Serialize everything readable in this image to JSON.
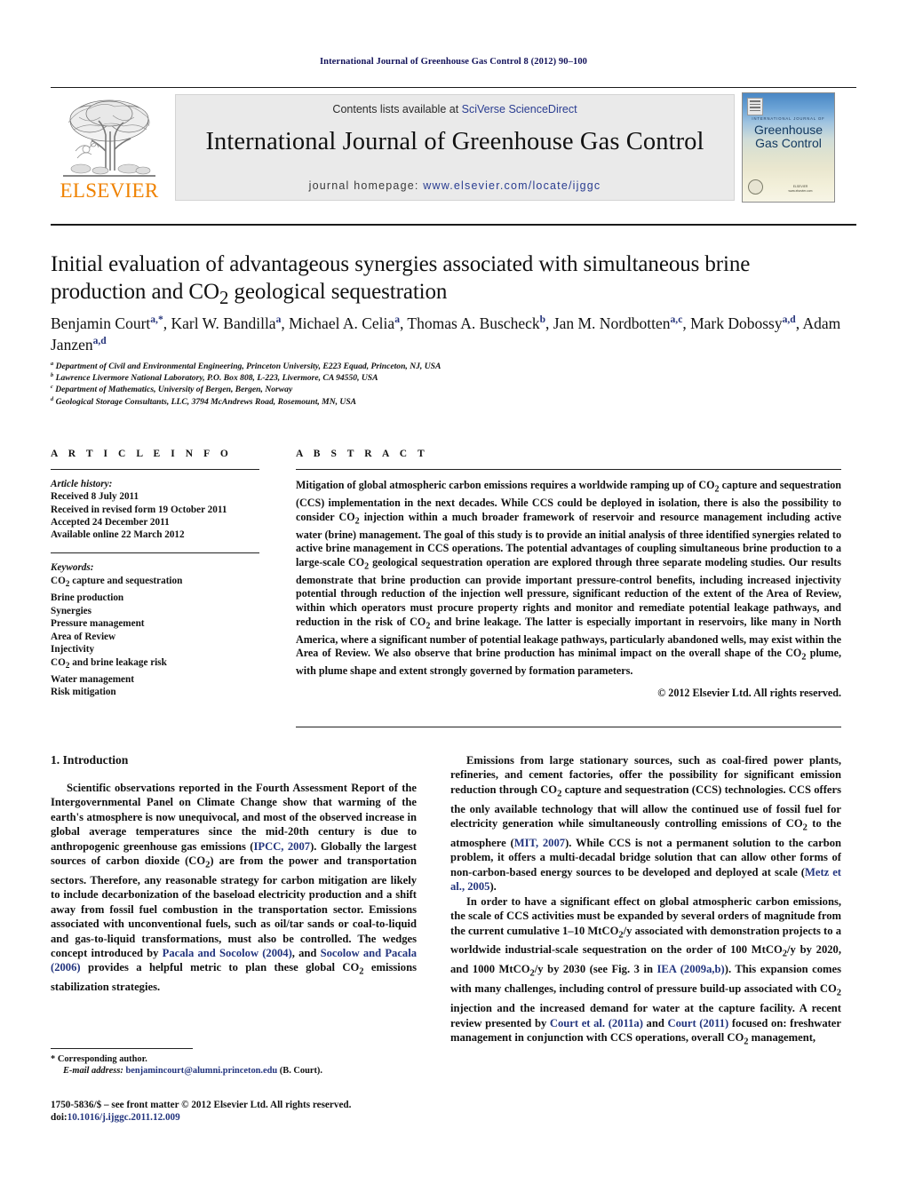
{
  "running_head": "International Journal of Greenhouse Gas Control 8 (2012) 90–100",
  "masthead": {
    "contents_prefix": "Contents lists available at ",
    "contents_link": "SciVerse ScienceDirect",
    "journal_title": "International Journal of Greenhouse Gas Control",
    "homepage_prefix": "journal homepage: ",
    "homepage_url": "www.elsevier.com/locate/ijggc",
    "publisher_logo_text": "ELSEVIER",
    "cover": {
      "kicker": "INTERNATIONAL JOURNAL OF",
      "line1": "Greenhouse",
      "line2": "Gas Control",
      "publisher": "ELSEVIER",
      "publisher_sub": "www.elsevier.com"
    }
  },
  "article": {
    "title_line1": "Initial evaluation of advantageous synergies associated with simultaneous brine",
    "title_line2_pre": "production and CO",
    "title_sub": "2",
    "title_line2_post": " geological sequestration",
    "authors_html": "Benjamin Court<sup>a,*</sup>, Karl W. Bandilla<sup>a</sup>, Michael A. Celia<sup>a</sup>, Thomas A. Buscheck<sup>b</sup>, Jan M. Nordbotten<sup>a,c</sup>, Mark Dobossy<sup>a,d</sup>, Adam Janzen<sup>a,d</sup>",
    "affiliations": [
      {
        "mark": "a",
        "text": "Department of Civil and Environmental Engineering, Princeton University, E223 Equad, Princeton, NJ, USA"
      },
      {
        "mark": "b",
        "text": "Lawrence Livermore National Laboratory, P.O. Box 808, L-223, Livermore, CA 94550, USA"
      },
      {
        "mark": "c",
        "text": "Department of Mathematics, University of Bergen, Bergen, Norway"
      },
      {
        "mark": "d",
        "text": "Geological Storage Consultants, LLC, 3794 McAndrews Road, Rosemount, MN, USA"
      }
    ]
  },
  "article_info": {
    "heading": "A R T I C L E   I N F O",
    "history_label": "Article history:",
    "history": [
      "Received 8 July 2011",
      "Received in revised form 19 October 2011",
      "Accepted 24 December 2011",
      "Available online 22 March 2012"
    ],
    "keywords_label": "Keywords:",
    "keywords": [
      "CO2 capture and sequestration",
      "Brine production",
      "Synergies",
      "Pressure management",
      "Area of Review",
      "Injectivity",
      "CO2 and brine leakage risk",
      "Water management",
      "Risk mitigation"
    ]
  },
  "abstract": {
    "heading": "A B S T R A C T",
    "text": "Mitigation of global atmospheric carbon emissions requires a worldwide ramping up of CO2 capture and sequestration (CCS) implementation in the next decades. While CCS could be deployed in isolation, there is also the possibility to consider CO2 injection within a much broader framework of reservoir and resource management including active water (brine) management. The goal of this study is to provide an initial analysis of three identified synergies related to active brine management in CCS operations. The potential advantages of coupling simultaneous brine production to a large-scale CO2 geological sequestration operation are explored through three separate modeling studies. Our results demonstrate that brine production can provide important pressure-control benefits, including increased injectivity potential through reduction of the injection well pressure, significant reduction of the extent of the Area of Review, within which operators must procure property rights and monitor and remediate potential leakage pathways, and reduction in the risk of CO2 and brine leakage. The latter is especially important in reservoirs, like many in North America, where a significant number of potential leakage pathways, particularly abandoned wells, may exist within the Area of Review. We also observe that brine production has minimal impact on the overall shape of the CO2 plume, with plume shape and extent strongly governed by formation parameters.",
    "copyright": "© 2012 Elsevier Ltd. All rights reserved."
  },
  "body": {
    "section_title": "1. Introduction",
    "left_paragraphs": [
      "Scientific observations reported in the Fourth Assessment Report of the Intergovernmental Panel on Climate Change show that warming of the earth's atmosphere is now unequivocal, and most of the observed increase in global average temperatures since the mid-20th century is due to anthropogenic greenhouse gas emissions (IPCC, 2007). Globally the largest sources of carbon dioxide (CO2) are from the power and transportation sectors. Therefore, any reasonable strategy for carbon mitigation are likely to include decarbonization of the baseload electricity production and a shift away from fossil fuel combustion in the transportation sector. Emissions associated with unconventional fuels, such as oil/tar sands or coal-to-liquid and gas-to-liquid transformations, must also be controlled. The wedges concept introduced by Pacala and Socolow (2004), and Socolow and Pacala (2006) provides a helpful metric to plan these global CO2 emissions stabilization strategies."
    ],
    "right_paragraphs": [
      "Emissions from large stationary sources, such as coal-fired power plants, refineries, and cement factories, offer the possibility for significant emission reduction through CO2 capture and sequestration (CCS) technologies. CCS offers the only available technology that will allow the continued use of fossil fuel for electricity generation while simultaneously controlling emissions of CO2 to the atmosphere (MIT, 2007). While CCS is not a permanent solution to the carbon problem, it offers a multi-decadal bridge solution that can allow other forms of non-carbon-based energy sources to be developed and deployed at scale (Metz et al., 2005).",
      "In order to have a significant effect on global atmospheric carbon emissions, the scale of CCS activities must be expanded by several orders of magnitude from the current cumulative 1–10 MtCO2/y associated with demonstration projects to a worldwide industrial-scale sequestration on the order of 100 MtCO2/y by 2020, and 1000 MtCO2/y by 2030 (see Fig. 3 in IEA (2009a,b)). This expansion comes with many challenges, including control of pressure build-up associated with CO2 injection and the increased demand for water at the capture facility. A recent review presented by Court et al. (2011a) and Court (2011) focused on: freshwater management in conjunction with CCS operations, overall CO2 management,"
    ]
  },
  "footnote": {
    "star": "*",
    "corresponding": "Corresponding author.",
    "email_label": "E-mail address:",
    "email": "benjamincourt@alumni.princeton.edu",
    "email_suffix": "(B. Court)."
  },
  "issn": {
    "line1": "1750-5836/$ – see front matter © 2012 Elsevier Ltd. All rights reserved.",
    "doi_label": "doi:",
    "doi": "10.1016/j.ijggc.2011.12.009"
  },
  "colors": {
    "link": "#23357e",
    "elsevier_orange": "#ef8200",
    "running_head": "#12125a",
    "band_bg": "#eaeaea"
  }
}
